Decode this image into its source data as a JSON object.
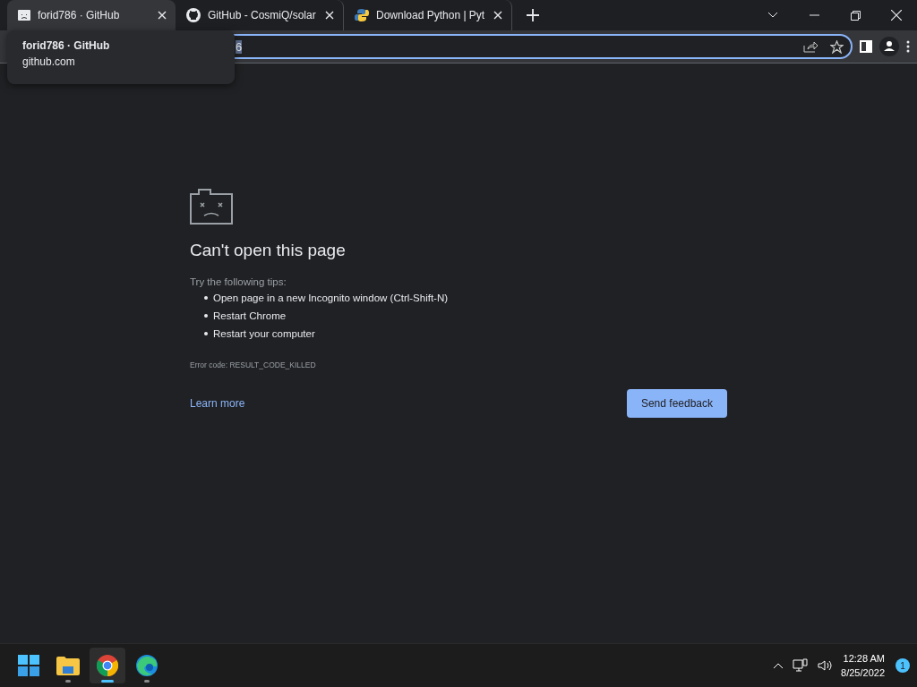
{
  "tabs": [
    {
      "title": "forid786 · GitHub",
      "kind": "sad",
      "selected": true
    },
    {
      "title": "GitHub - CosmiQ/solar",
      "kind": "github",
      "selected": false
    },
    {
      "title": "Download Python | Pyt",
      "kind": "python",
      "selected": false
    }
  ],
  "tooltip": {
    "title": "forid786 · GitHub",
    "url": "github.com"
  },
  "address": {
    "value": "6"
  },
  "error": {
    "heading": "Can't open this page",
    "intro": "Try the following tips:",
    "tips": [
      "Open page in a new Incognito window (Ctrl-Shift-N)",
      "Restart Chrome",
      "Restart your computer"
    ],
    "code": "Error code: RESULT_CODE_KILLED",
    "link": "Learn more",
    "button": "Send feedback"
  },
  "taskbar": {
    "apps": [
      {
        "kind": "start",
        "running": false,
        "selected": false
      },
      {
        "kind": "folder",
        "running": true,
        "selected": false
      },
      {
        "kind": "chrome",
        "running": true,
        "selected": true
      },
      {
        "kind": "edge",
        "running": true,
        "selected": false
      }
    ],
    "time": "12:28 AM",
    "date": "8/25/2022",
    "badge": "1"
  }
}
